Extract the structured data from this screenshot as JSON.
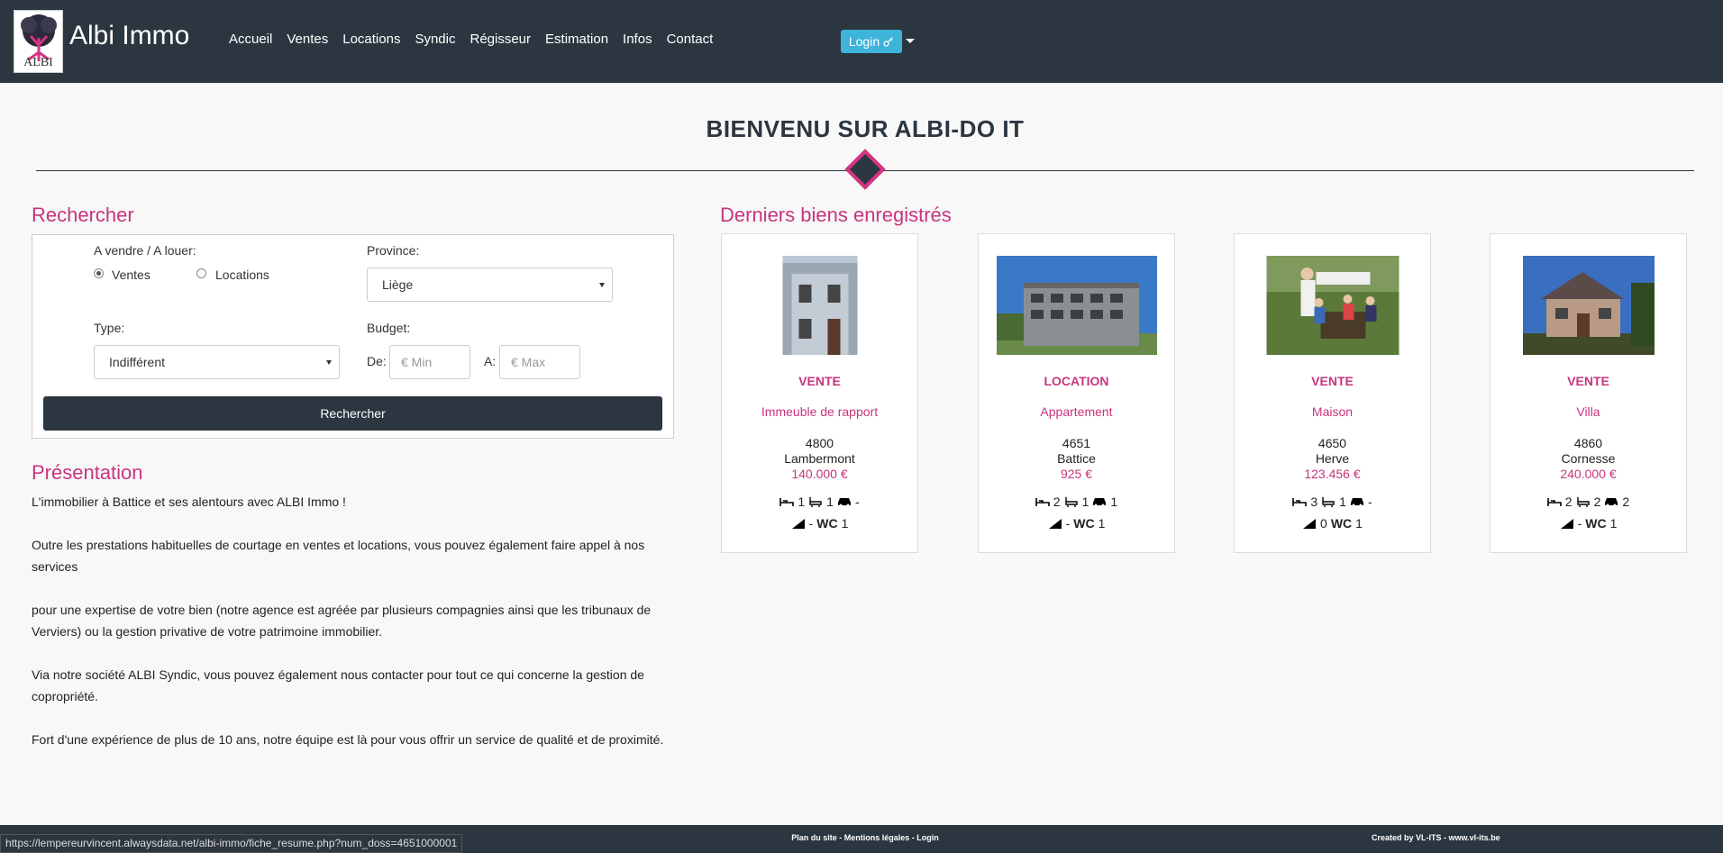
{
  "header": {
    "brand": "Albi Immo",
    "logo_text": "ALBI",
    "nav": [
      "Accueil",
      "Ventes",
      "Locations",
      "Syndic",
      "Régisseur",
      "Estimation",
      "Infos",
      "Contact"
    ],
    "login_label": "Login"
  },
  "welcome": "BIENVENU SUR ALBI-DO IT",
  "search": {
    "title": "Rechercher",
    "sale_rent_label": "A vendre / A louer:",
    "radio_sale": "Ventes",
    "radio_rent": "Locations",
    "province_label": "Province:",
    "province_value": "Liège",
    "type_label": "Type:",
    "type_value": "Indifférent",
    "budget_label": "Budget:",
    "de_label": "De:",
    "a_label": "A:",
    "min_placeholder": "€ Min",
    "max_placeholder": "€ Max",
    "button": "Rechercher"
  },
  "presentation": {
    "title": "Présentation",
    "paragraphs": [
      "L'immobilier à Battice et ses alentours avec ALBI Immo !",
      "Outre les prestations habituelles de courtage en ventes et locations, vous pouvez également faire appel à nos services",
      "pour une expertise de votre bien (notre agence est agréée par plusieurs compagnies ainsi que les tribunaux de Verviers) ou la gestion privative de votre patrimoine immobilier.",
      "Via notre société ALBI Syndic, vous pouvez également nous contacter pour tout ce qui concerne la gestion de copropriété.",
      "Fort d'une expérience de plus de 10 ans, notre équipe est là pour vous offrir un service de qualité et de proximité."
    ]
  },
  "listings": {
    "title": "Derniers biens enregistrés",
    "cards": [
      {
        "kind": "VENTE",
        "type": "Immeuble de rapport",
        "zip": "4800",
        "city": "Lambermont",
        "price": "140.000 €",
        "beds": "1",
        "baths": "1",
        "cars": "-",
        "floors": "-",
        "wc": "1"
      },
      {
        "kind": "LOCATION",
        "type": "Appartement",
        "zip": "4651",
        "city": "Battice",
        "price": "925 €",
        "beds": "2",
        "baths": "1",
        "cars": "1",
        "floors": "-",
        "wc": "1"
      },
      {
        "kind": "VENTE",
        "type": "Maison",
        "zip": "4650",
        "city": "Herve",
        "price": "123.456 €",
        "beds": "3",
        "baths": "1",
        "cars": "-",
        "floors": "0",
        "wc": "1"
      },
      {
        "kind": "VENTE",
        "type": "Villa",
        "zip": "4860",
        "city": "Cornesse",
        "price": "240.000 €",
        "beds": "2",
        "baths": "2",
        "cars": "2",
        "floors": "-",
        "wc": "1"
      }
    ],
    "wc_label": "WC"
  },
  "footer": {
    "links": "Plan du site - Mentions légales - Login",
    "credit": "Created by VL-ITS - www.vl-its.be"
  },
  "status_url": "https://lempereurvincent.alwaysdata.net/albi-immo/fiche_resume.php?num_doss=4651000001",
  "colors": {
    "navbar": "#2c3640",
    "accent": "#c8347e",
    "login": "#3eb4db"
  }
}
